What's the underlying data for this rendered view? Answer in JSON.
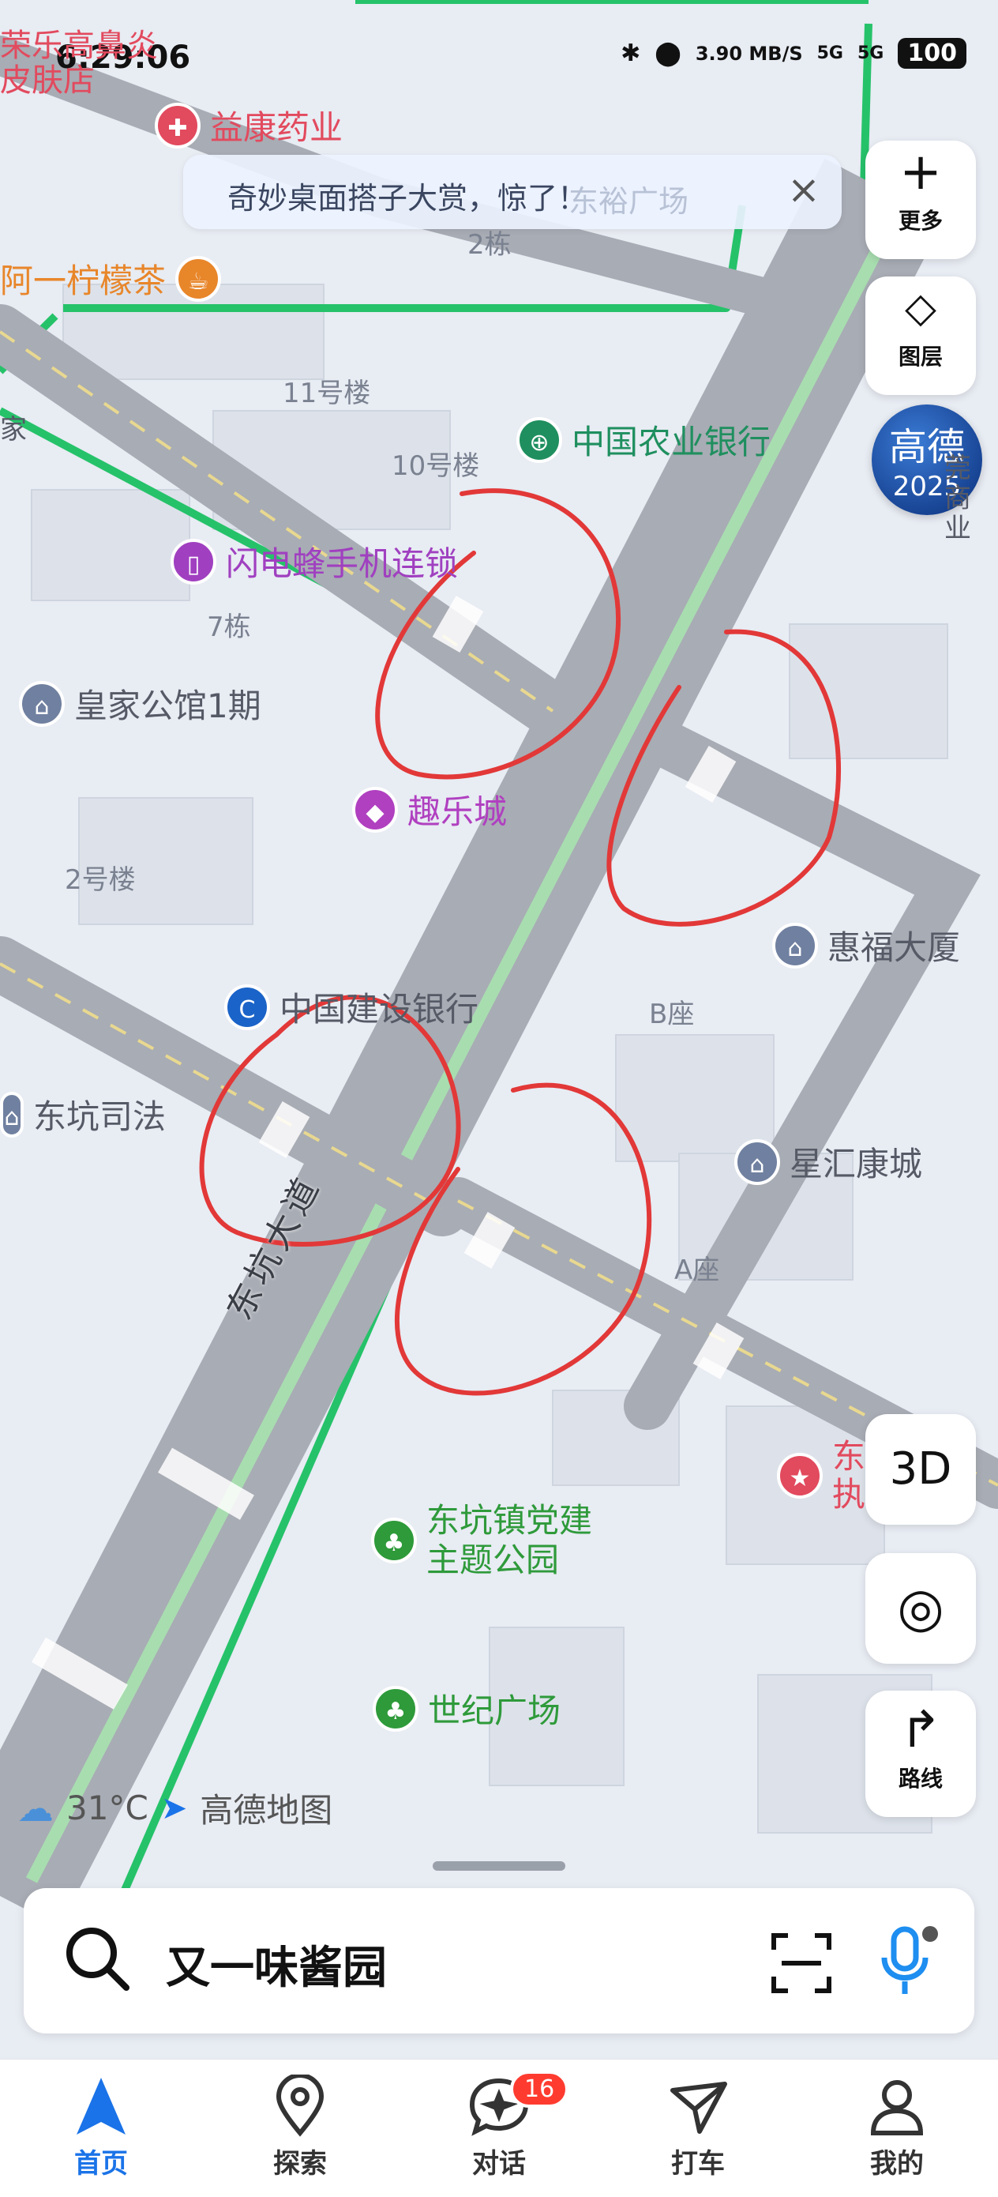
{
  "status_bar": {
    "time": "6:29:06",
    "speed": "3.90 MB/S",
    "network_1": "5G",
    "network_2": "5G",
    "battery": "100"
  },
  "notification": {
    "text": "奇妙桌面搭子大赏，惊了！",
    "close_icon": "close-icon"
  },
  "map_side_buttons": {
    "more_label": "更多",
    "layers_label": "图层",
    "badge_line1": "高德",
    "badge_line2": "2025",
    "three_d_label": "3D",
    "route_label": "路线"
  },
  "pois": [
    {
      "name": "荣乐高鼻炎皮肤店",
      "color": "#e24a5e"
    },
    {
      "name": "益康药业",
      "color": "#e24a5e"
    },
    {
      "name": "阿一柠檬茶",
      "color": "#e8862a"
    },
    {
      "name": "中国农业银行",
      "color": "#1f8f5f"
    },
    {
      "name": "闪电蜂手机连锁",
      "color": "#a040c0"
    },
    {
      "name": "皇家公馆1期",
      "color": "#7080a0"
    },
    {
      "name": "趣乐城",
      "color": "#b040c0"
    },
    {
      "name": "惠福大厦",
      "color": "#7080a0"
    },
    {
      "name": "中国建设银行",
      "color": "#1a63c8"
    },
    {
      "name": "东坑司法",
      "color": "#7080a0"
    },
    {
      "name": "星汇康城",
      "color": "#7080a0"
    },
    {
      "name": "东坑镇党建主题公园",
      "color": "#2e9a3a"
    },
    {
      "name": "世纪广场",
      "color": "#2e9a3a"
    },
    {
      "name": "东执",
      "color": "#e24a5e"
    }
  ],
  "building_labels": [
    "2栋",
    "东裕广场",
    "11号楼",
    "10号楼",
    "7栋",
    "2号楼",
    "B座",
    "A座",
    "家",
    "莞商业"
  ],
  "road_label": "东坑大道",
  "weather": {
    "temp": "31°C",
    "brand": "高德地图"
  },
  "search": {
    "query": "又一味酱园"
  },
  "bottom_nav": {
    "home": "首页",
    "explore": "探索",
    "chat": "对话",
    "chat_badge": "16",
    "taxi": "打车",
    "mine": "我的"
  }
}
